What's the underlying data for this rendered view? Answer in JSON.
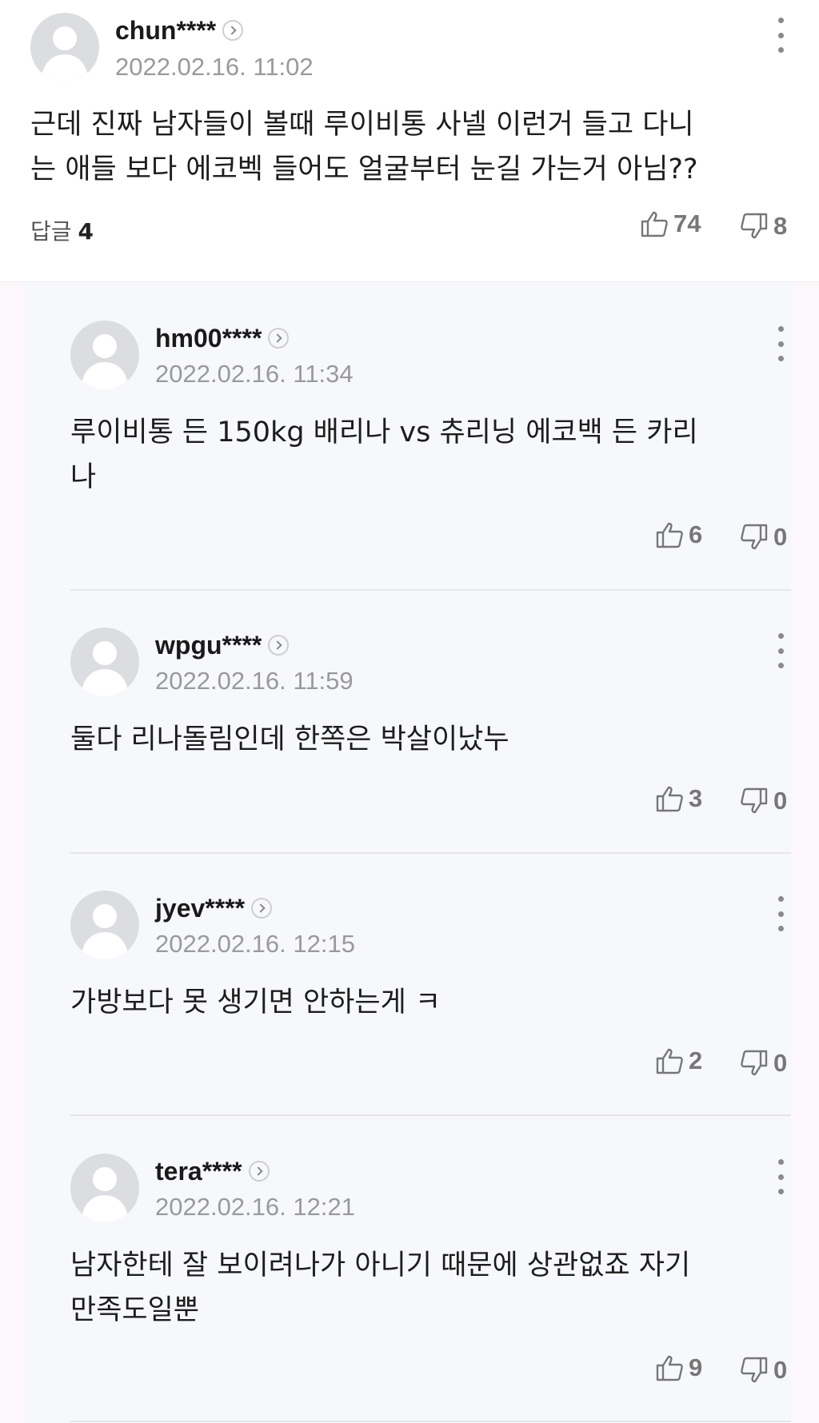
{
  "main_comment": {
    "username": "chun****",
    "timestamp": "2022.02.16. 11:02",
    "text_line1": "근데 진짜 남자들이 볼때 루이비통 사넬 이런거 들고 다니",
    "text_line2": "는 애들 보다 에코벡 들어도 얼굴부터 눈길 가는거 아님??",
    "reply_label": "답글",
    "reply_count": "4",
    "likes": "74",
    "dislikes": "8"
  },
  "replies": [
    {
      "username": "hm00****",
      "timestamp": "2022.02.16. 11:34",
      "text_line1": "루이비통 든 150kg 배리나 vs 츄리닝 에코백 든 카리",
      "text_line2": "나",
      "likes": "6",
      "dislikes": "0"
    },
    {
      "username": "wpgu****",
      "timestamp": "2022.02.16. 11:59",
      "text_line1": "둘다 리나돌림인데 한쪽은 박살이났누",
      "text_line2": "",
      "likes": "3",
      "dislikes": "0"
    },
    {
      "username": "jyev****",
      "timestamp": "2022.02.16. 12:15",
      "text_line1": "가방보다 못 생기면 안하는게 ㅋ",
      "text_line2": "",
      "likes": "2",
      "dislikes": "0"
    },
    {
      "username": "tera****",
      "timestamp": "2022.02.16. 12:21",
      "text_line1": "남자한테 잘 보이려나가 아니기 때문에 상관없죠 자기",
      "text_line2": "만족도일뿐",
      "likes": "9",
      "dislikes": "0"
    }
  ],
  "icons": {
    "avatar": "default-user-avatar",
    "profile": "chevron-right-circle-icon",
    "more": "more-vertical-icon",
    "like": "thumbs-up-icon",
    "dislike": "thumbs-down-icon"
  },
  "colors": {
    "reply_background": "#f7f8fc",
    "muted_text": "#9a9a9a",
    "avatar_gray": "#dcdde1"
  }
}
